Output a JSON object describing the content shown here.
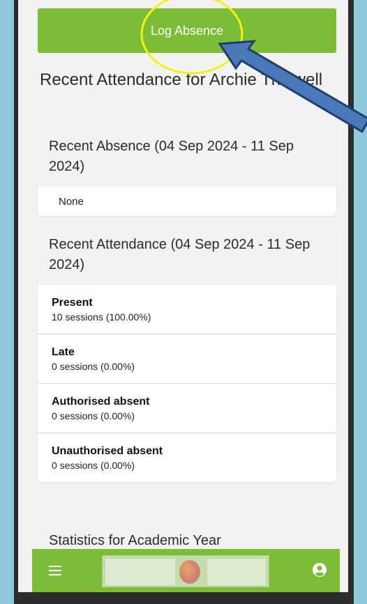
{
  "log_absence": {
    "label": "Log Absence"
  },
  "page": {
    "heading": "Recent Attendance for Archie Thelwell"
  },
  "recent_absence": {
    "title": "Recent Absence (04 Sep 2024 - 11 Sep 2024)",
    "value": "None"
  },
  "recent_attendance": {
    "title": "Recent Attendance (04 Sep 2024 - 11 Sep 2024)",
    "items": [
      {
        "label": "Present",
        "value": "10 sessions (100.00%)"
      },
      {
        "label": "Late",
        "value": "0 sessions (0.00%)"
      },
      {
        "label": "Authorised absent",
        "value": "0 sessions (0.00%)"
      },
      {
        "label": "Unauthorised absent",
        "value": "0 sessions (0.00%)"
      }
    ]
  },
  "statistics": {
    "title": "Statistics for Academic Year"
  },
  "bottom_nav": {
    "menu_icon": "hamburger-menu-icon",
    "profile_icon": "user-profile-icon"
  },
  "colors": {
    "accent": "#7cbd38",
    "annotation_circle": "#f2f215",
    "annotation_arrow": "#4a78b8"
  }
}
